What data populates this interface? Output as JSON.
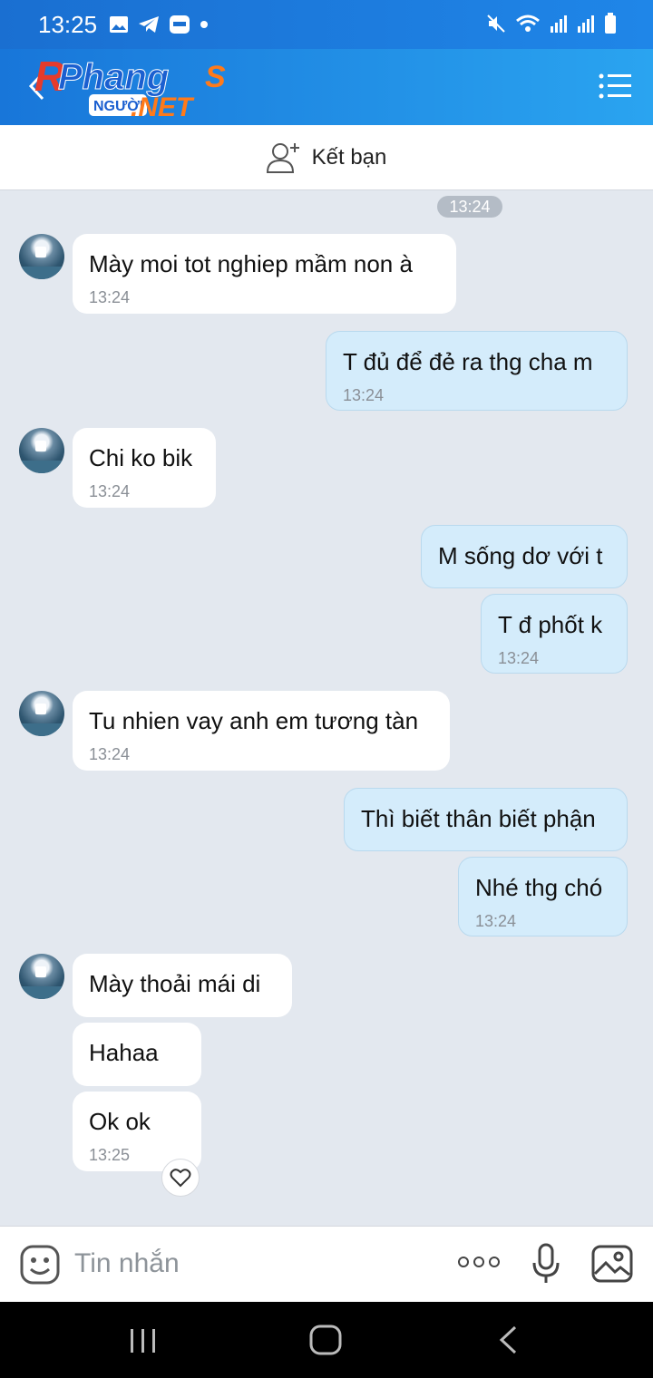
{
  "status_bar": {
    "time": "13:25"
  },
  "header": {
    "logo_main": "Phang",
    "logo_s": "S",
    "logo_sub": "NGƯỜI",
    "logo_net": ".NET"
  },
  "add_friend": {
    "label": "Kết bạn"
  },
  "chat": {
    "date_pill": "13:24",
    "messages": [
      {
        "text": "Mày moi tot nghiep mầm non à",
        "time": "13:24"
      },
      {
        "text": "T đủ để đẻ ra thg cha m",
        "time": "13:24"
      },
      {
        "text": "Chi ko bik",
        "time": "13:24"
      },
      {
        "text": "M sống dơ với t",
        "time": ""
      },
      {
        "text": "T đ phốt k",
        "time": "13:24"
      },
      {
        "text": "Tu nhien vay anh em tương tàn",
        "time": "13:24"
      },
      {
        "text": "Thì biết thân biết phận",
        "time": ""
      },
      {
        "text": "Nhé thg chó",
        "time": "13:24"
      },
      {
        "text": "Mày thoải mái di",
        "time": ""
      },
      {
        "text": "Hahaa",
        "time": ""
      },
      {
        "text": "Ok ok",
        "time": "13:25"
      }
    ]
  },
  "input": {
    "placeholder": "Tin nhắn"
  },
  "icons": [
    "photo-icon",
    "telegram-icon",
    "zalo-icon",
    "mute-icon",
    "wifi-icon",
    "signal-icon",
    "battery-icon",
    "back-arrow-icon",
    "menu-icon",
    "add-friend-icon",
    "heart-icon",
    "emoji-icon",
    "more-icon",
    "mic-icon",
    "image-icon",
    "nav-recent-icon",
    "nav-home-icon",
    "nav-back-icon"
  ],
  "colors": {
    "header_blue": "#1f86e8",
    "incoming_bubble": "#ffffff",
    "outgoing_bubble": "#d4ecfb",
    "chat_bg": "#e3e8ef"
  }
}
